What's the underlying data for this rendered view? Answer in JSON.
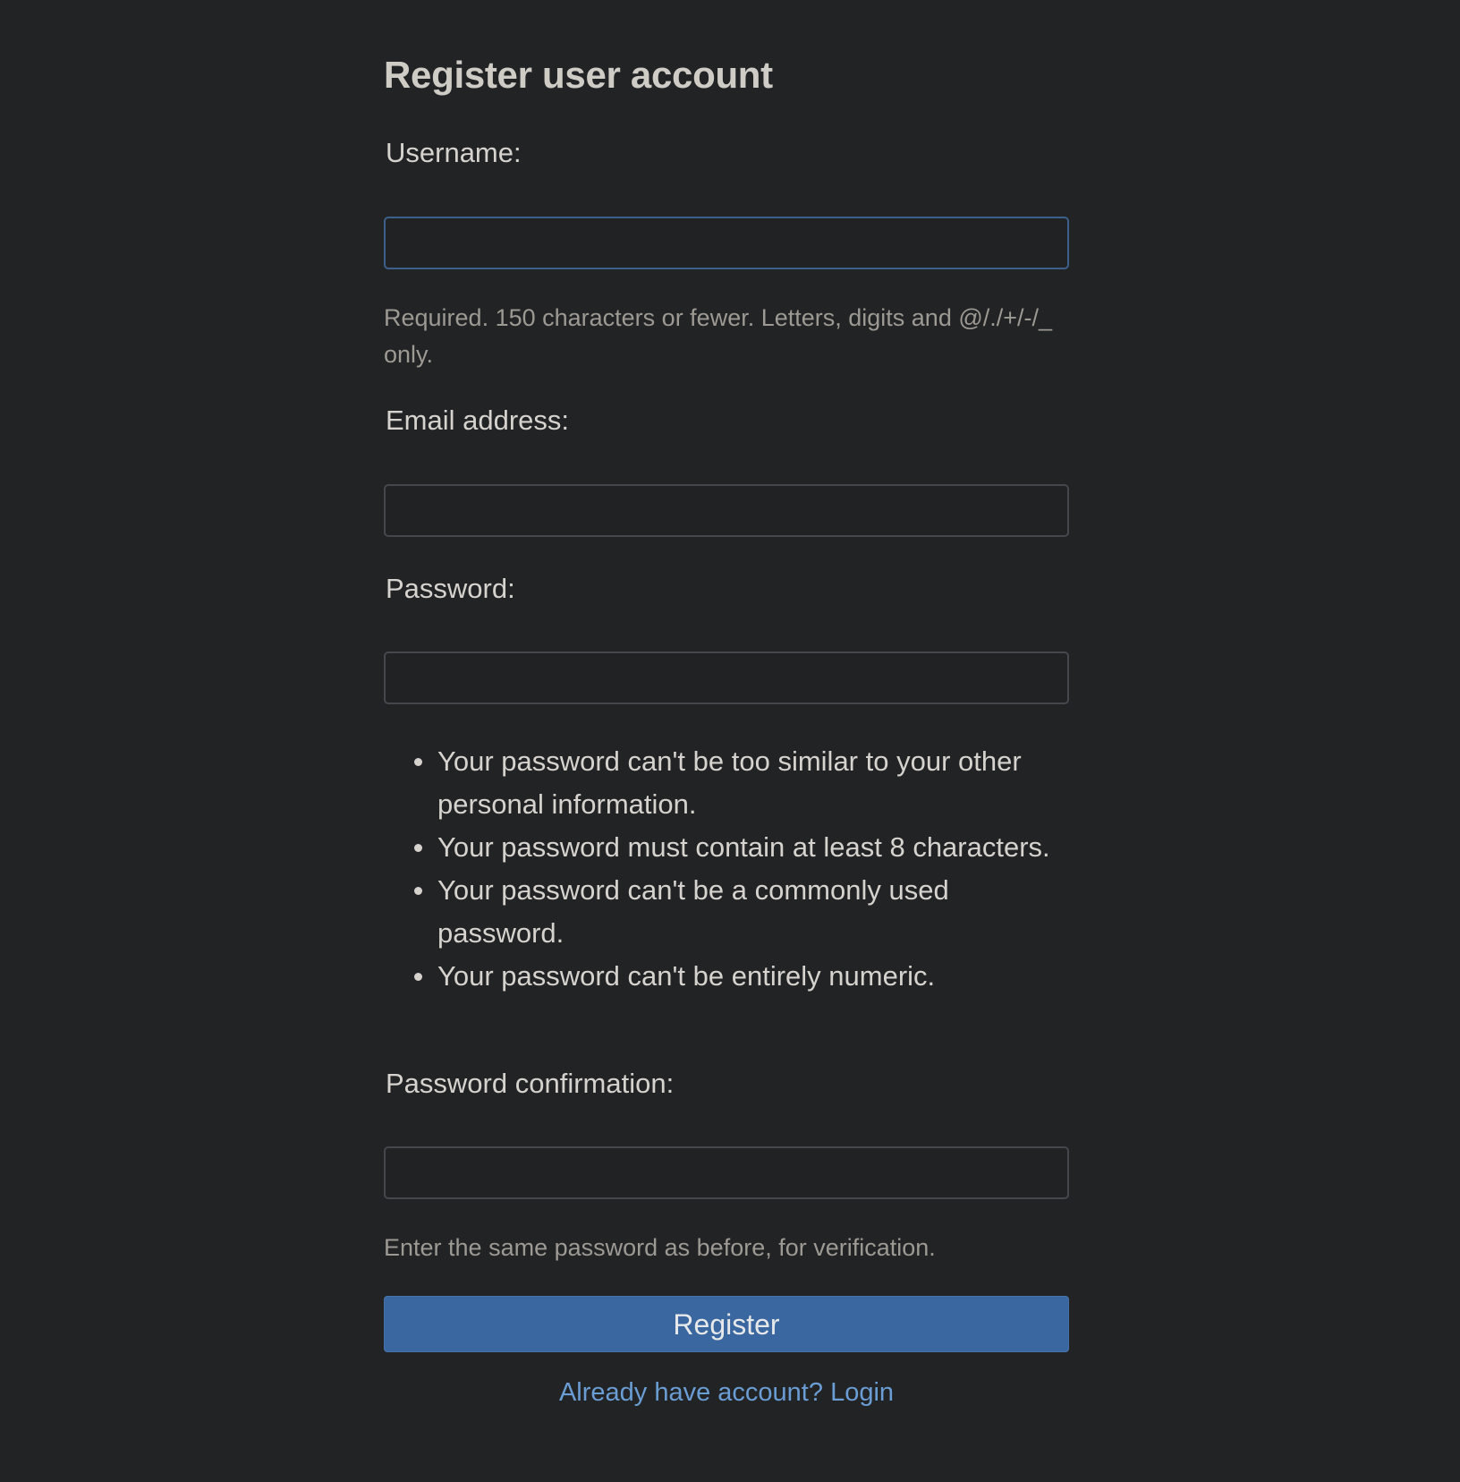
{
  "page": {
    "title": "Register user account"
  },
  "fields": {
    "username": {
      "label": "Username:",
      "value": "",
      "help": "Required. 150 characters or fewer. Letters, digits and @/./+/-/_ only."
    },
    "email": {
      "label": "Email address:",
      "value": ""
    },
    "password": {
      "label": "Password:",
      "value": "",
      "rules": [
        "Your password can't be too similar to your other personal information.",
        "Your password must contain at least 8 characters.",
        "Your password can't be a commonly used password.",
        "Your password can't be entirely numeric."
      ]
    },
    "password_confirmation": {
      "label": "Password confirmation:",
      "value": "",
      "help": "Enter the same password as before, for verification."
    }
  },
  "actions": {
    "register_label": "Register",
    "login_prompt": "Already have account?",
    "login_link": "Login"
  },
  "colors": {
    "background": "#222325",
    "primary_button": "#3a679f",
    "link": "#6a9dd3",
    "focus_border": "#3d5f8c"
  }
}
